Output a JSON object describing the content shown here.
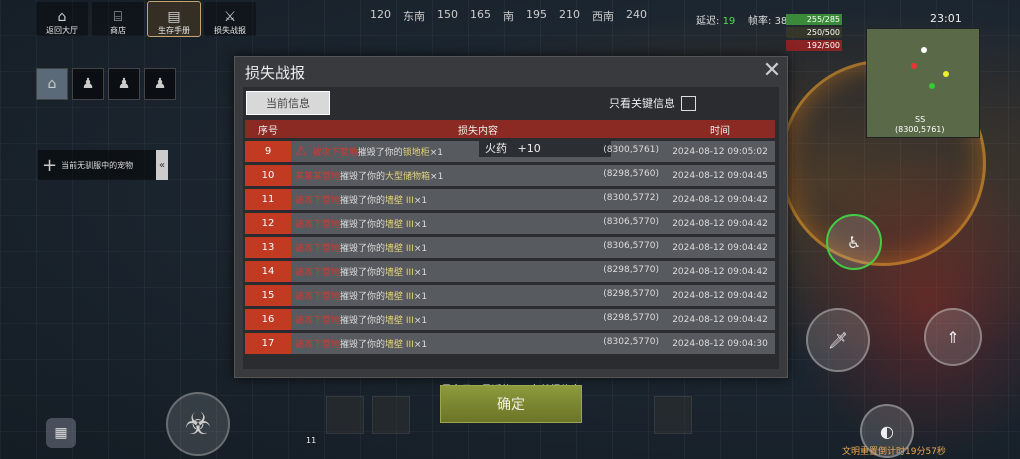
{
  "topnav": [
    {
      "label": "返回大厅",
      "icon": "home-icon"
    },
    {
      "label": "商店",
      "icon": "shop-icon"
    },
    {
      "label": "生存手册",
      "icon": "handbook-icon",
      "active": true
    },
    {
      "label": "损失战报",
      "icon": "crossed-swords-icon"
    }
  ],
  "compass": [
    "120",
    "东南",
    "150",
    "165",
    "南",
    "195",
    "210",
    "西南",
    "240"
  ],
  "status": {
    "latency_label": "延迟:",
    "latency_value": "19",
    "fps_label": "帧率:",
    "fps_value": "38",
    "clock": "23:01"
  },
  "hp": [
    "255/285",
    "250/500",
    "192/500"
  ],
  "minimap": {
    "label": "SS",
    "coords": "(8300,5761)"
  },
  "left": {
    "pet_slot": "当前无驯服中的宠物"
  },
  "dialog": {
    "title": "损失战报",
    "tab": "当前信息",
    "filter_label": "只看关键信息",
    "headers": {
      "index": "序号",
      "content": "损失内容",
      "time": "时间"
    },
    "popup": {
      "item": "火药",
      "amount": "+10"
    },
    "rows": [
      {
        "index": "9",
        "attacker": "被攻下营地",
        "action": "摧毁了你的",
        "item": "锁地柜",
        "count": "×1",
        "coord": "(8300,5761)",
        "time": "2024-08-12 09:05:02",
        "warn": true
      },
      {
        "index": "10",
        "attacker": "某某某营地",
        "action": "摧毁了你的",
        "item": "大型储物箱",
        "count": "×1",
        "coord": "(8298,5760)",
        "time": "2024-08-12 09:04:45"
      },
      {
        "index": "11",
        "attacker": "被攻下营地",
        "action": "摧毁了你的",
        "item": "墙壁 III",
        "count": "×1",
        "coord": "(8300,5772)",
        "time": "2024-08-12 09:04:42"
      },
      {
        "index": "12",
        "attacker": "被攻下营地",
        "action": "摧毁了你的",
        "item": "墙壁 III",
        "count": "×1",
        "coord": "(8306,5770)",
        "time": "2024-08-12 09:04:42"
      },
      {
        "index": "13",
        "attacker": "被攻下营地",
        "action": "摧毁了你的",
        "item": "墙壁 III",
        "count": "×1",
        "coord": "(8306,5770)",
        "time": "2024-08-12 09:04:42"
      },
      {
        "index": "14",
        "attacker": "被攻下营地",
        "action": "摧毁了你的",
        "item": "墙壁 III",
        "count": "×1",
        "coord": "(8298,5770)",
        "time": "2024-08-12 09:04:42"
      },
      {
        "index": "15",
        "attacker": "被攻下营地",
        "action": "摧毁了你的",
        "item": "墙壁 III",
        "count": "×1",
        "coord": "(8298,5770)",
        "time": "2024-08-12 09:04:42"
      },
      {
        "index": "16",
        "attacker": "被攻下营地",
        "action": "摧毁了你的",
        "item": "墙壁 III",
        "count": "×1",
        "coord": "(8298,5770)",
        "time": "2024-08-12 09:04:42"
      },
      {
        "index": "17",
        "attacker": "被攻下营地",
        "action": "摧毁了你的",
        "item": "墙壁 III",
        "count": "×1",
        "coord": "(8302,5770)",
        "time": "2024-08-12 09:04:30"
      }
    ],
    "footer": "最多显示最近的200条战报信息",
    "confirm": "确定"
  },
  "hotbar": {
    "number": "11"
  },
  "bottom_timer": "文明重置倒计时19分57秒",
  "colors": {
    "header_red": "#8a2a22",
    "index_red": "#c23a22",
    "attacker_red": "#cc3a33",
    "item_yellow": "#e4d27a",
    "confirm_green": "#8c9a3c"
  }
}
